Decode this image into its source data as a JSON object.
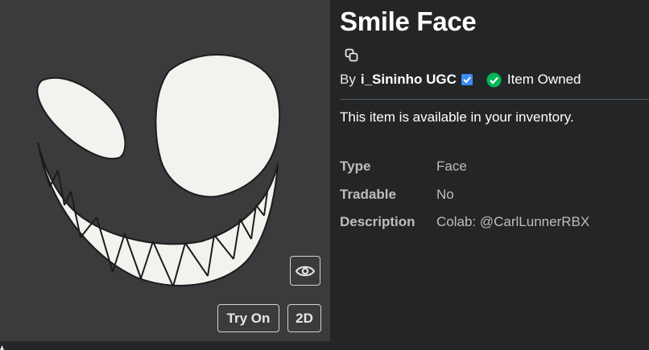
{
  "item": {
    "title": "Smile Face",
    "by_prefix": "By",
    "creator": "i_Sininho UGC",
    "owned_label": "Item Owned",
    "availability": "This item is available in your inventory."
  },
  "details": [
    {
      "label": "Type",
      "value": "Face"
    },
    {
      "label": "Tradable",
      "value": "No"
    },
    {
      "label": "Description",
      "value": "Colab: @CarlLunnerRBX"
    }
  ],
  "preview": {
    "try_on_label": "Try On",
    "view_2d_label": "2D"
  },
  "colors": {
    "page_background": "#232527",
    "preview_background": "#393b3d",
    "verified_badge": "#3b8cf6",
    "owned_check": "#02b757"
  },
  "icons": [
    "copy-icon",
    "verified-badge-icon",
    "checkmark-circle-icon",
    "eye-icon"
  ]
}
